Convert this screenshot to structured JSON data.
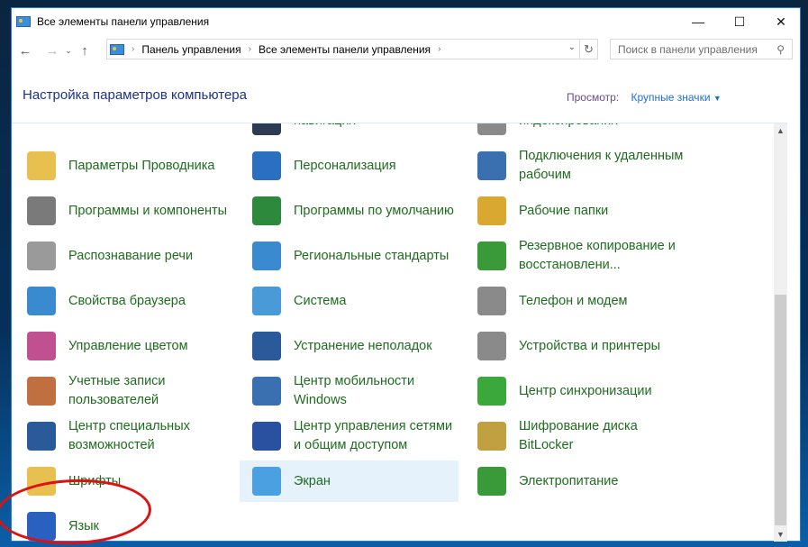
{
  "window": {
    "title": "Все элементы панели управления"
  },
  "nav": {
    "breadcrumb": [
      "Панель управления",
      "Все элементы панели управления"
    ],
    "search_placeholder": "Поиск в панели управления"
  },
  "header": {
    "title": "Настройка параметров компьютера",
    "view_label": "Просмотр:",
    "view_value": "Крупные значки"
  },
  "items": [
    {
      "label": "навигация",
      "color": "#2d3b55"
    },
    {
      "label": "индексирования",
      "color": "#8a8a8a"
    },
    {
      "label": "Параметры Проводника",
      "color": "#e8c050"
    },
    {
      "label": "Персонализация",
      "color": "#2a6fc0"
    },
    {
      "label": "Подключения к удаленным рабочим",
      "color": "#3a70b0"
    },
    {
      "label": "Программы и компоненты",
      "color": "#7a7a7a"
    },
    {
      "label": "Программы по умолчанию",
      "color": "#2d8a3c"
    },
    {
      "label": "Рабочие папки",
      "color": "#d8a830"
    },
    {
      "label": "Распознавание речи",
      "color": "#9a9a9a"
    },
    {
      "label": "Региональные стандарты",
      "color": "#3a8ad0"
    },
    {
      "label": "Резервное копирование и восстановлени...",
      "color": "#3a9a3a"
    },
    {
      "label": "Свойства браузера",
      "color": "#3a8ad0"
    },
    {
      "label": "Система",
      "color": "#4a9ad8"
    },
    {
      "label": "Телефон и модем",
      "color": "#8a8a8a"
    },
    {
      "label": "Управление цветом",
      "color": "#c05090"
    },
    {
      "label": "Устранение неполадок",
      "color": "#2a5a9a"
    },
    {
      "label": "Устройства и принтеры",
      "color": "#8a8a8a"
    },
    {
      "label": "Учетные записи пользователей",
      "color": "#c07040"
    },
    {
      "label": "Центр мобильности Windows",
      "color": "#3a70b0"
    },
    {
      "label": "Центр синхронизации",
      "color": "#3aa83a"
    },
    {
      "label": "Центр специальных возможностей",
      "color": "#2a5a9a"
    },
    {
      "label": "Центр управления сетями и общим доступом",
      "color": "#2a50a0"
    },
    {
      "label": "Шифрование диска BitLocker",
      "color": "#c0a040"
    },
    {
      "label": "Шрифты",
      "color": "#e8c050"
    },
    {
      "label": "Экран",
      "color": "#4aa0e0"
    },
    {
      "label": "Электропитание",
      "color": "#3a9a3a"
    },
    {
      "label": "Язык",
      "color": "#2a60c0"
    }
  ]
}
